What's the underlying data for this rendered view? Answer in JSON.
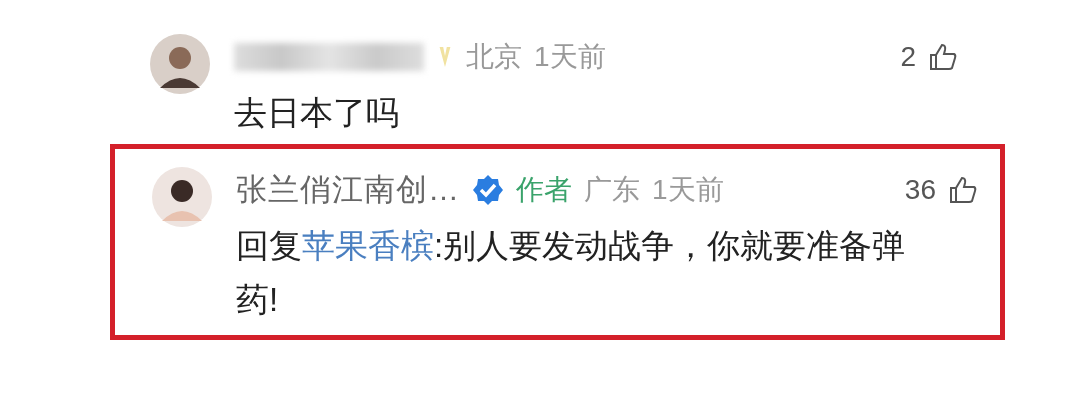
{
  "comments": [
    {
      "name_hidden": true,
      "verified": false,
      "badge": true,
      "location": "北京",
      "time": "1天前",
      "likes": "2",
      "text": "去日本了吗",
      "highlighted": false
    },
    {
      "name_hidden": false,
      "name": "张兰俏江南创…",
      "verified": true,
      "badge": false,
      "author_tag": "作者",
      "location": "广东",
      "time": "1天前",
      "likes": "36",
      "reply_prefix": "回复",
      "reply_to": "苹果香槟",
      "text": ":别人要发动战争，你就要准备弹药!",
      "highlighted": true
    }
  ]
}
